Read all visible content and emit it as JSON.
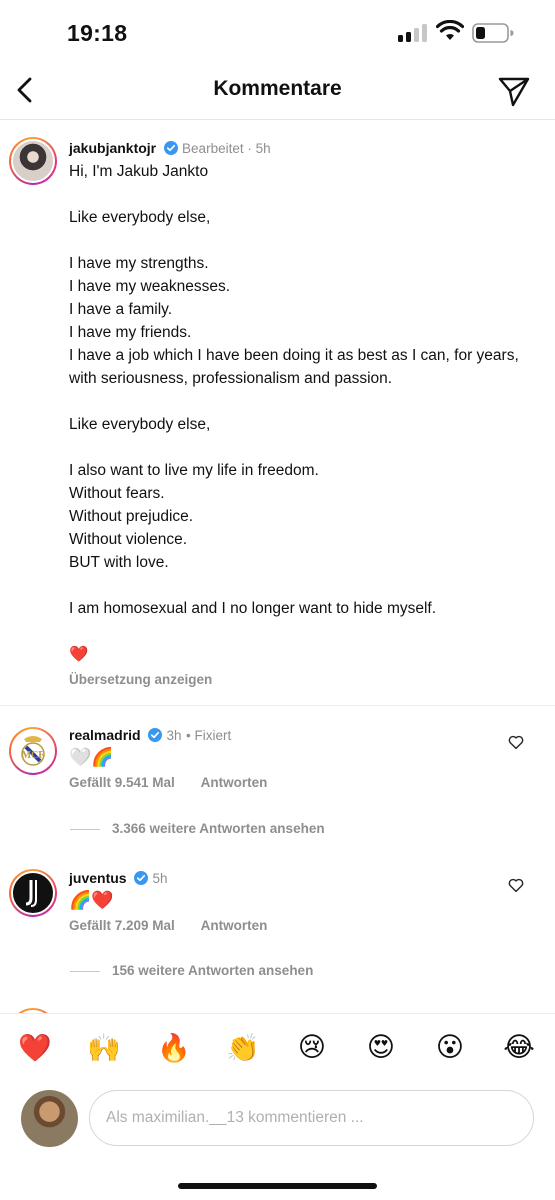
{
  "status": {
    "time": "19:18"
  },
  "header": {
    "title": "Kommentare"
  },
  "caption": {
    "username": "jakubjanktojr",
    "meta": "Bearbeitet · 5h",
    "lines": [
      "Hi, I'm Jakub Jankto",
      "",
      "Like everybody else,",
      "",
      "I have my strengths.",
      "I have my weaknesses.",
      "I have a family.",
      "I have my friends.",
      "I have a job which I have been doing it as best as I can, for years, with seriousness, professionalism and passion.",
      "",
      "Like everybody else,",
      "",
      "I also want to live my life in freedom.",
      "Without fears.",
      "Without prejudice.",
      "Without violence.",
      "BUT with love.",
      "",
      "I am homosexual and I no longer want to hide myself.",
      "",
      "❤️"
    ],
    "translate": "Übersetzung anzeigen"
  },
  "comments": [
    {
      "username": "realmadrid",
      "time": "3h",
      "pinned": "Fixiert",
      "text": "🤍🌈",
      "likes": "Gefällt 9.541 Mal",
      "reply": "Antworten",
      "more_replies": "3.366 weitere Antworten ansehen"
    },
    {
      "username": "juventus",
      "time": "5h",
      "text": "🌈❤️",
      "likes": "Gefällt 7.209 Mal",
      "reply": "Antworten",
      "more_replies": "156 weitere Antworten ansehen"
    }
  ],
  "quick_reactions": [
    "❤️",
    "🙌",
    "🔥",
    "👏",
    "😢",
    "😍",
    "😮",
    "😂"
  ],
  "composer": {
    "placeholder": "Als maximilian.__13 kommentieren ..."
  },
  "colors": {
    "verified": "#3897f0",
    "muted": "#8e8e8e"
  },
  "icons": {
    "back": "chevron-left-icon",
    "send": "paper-plane-icon",
    "like": "heart-outline-icon"
  }
}
